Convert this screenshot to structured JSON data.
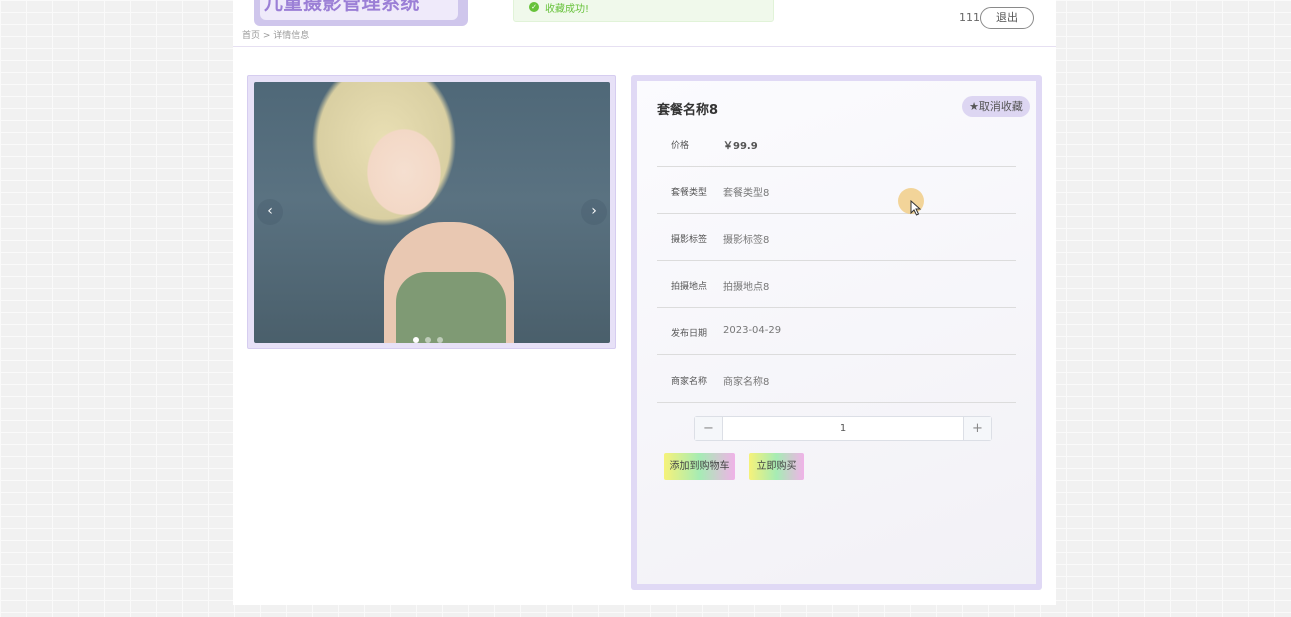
{
  "header": {
    "logo_text": "儿童摄影管理系统",
    "username": "111",
    "logout_label": "退出"
  },
  "toast": {
    "message": "收藏成功!",
    "icon": "check-circle-icon"
  },
  "breadcrumb": {
    "text": "首页 > 详情信息"
  },
  "carousel": {
    "prev_icon": "‹",
    "next_icon": "›",
    "slide_count": 3,
    "active_index": 0
  },
  "product": {
    "title": "套餐名称8",
    "favorite_label": "★取消收藏",
    "rows": [
      {
        "label": "价格",
        "value": "￥99.9"
      },
      {
        "label": "套餐类型",
        "value": "套餐类型8"
      },
      {
        "label": "摄影标签",
        "value": "摄影标签8"
      },
      {
        "label": "拍摄地点",
        "value": "拍摄地点8"
      },
      {
        "label": "发布日期",
        "value": "2023-04-29"
      },
      {
        "label": "商家名称",
        "value": "商家名称8"
      }
    ]
  },
  "quantity": {
    "minus": "−",
    "value": "1",
    "plus": "+"
  },
  "actions": {
    "add_to_cart": "添加到购物车",
    "buy_now": "立即购买"
  },
  "colors": {
    "accent": "#9b7fd6",
    "frame": "#e0d9f5",
    "success": "#67c23a"
  }
}
